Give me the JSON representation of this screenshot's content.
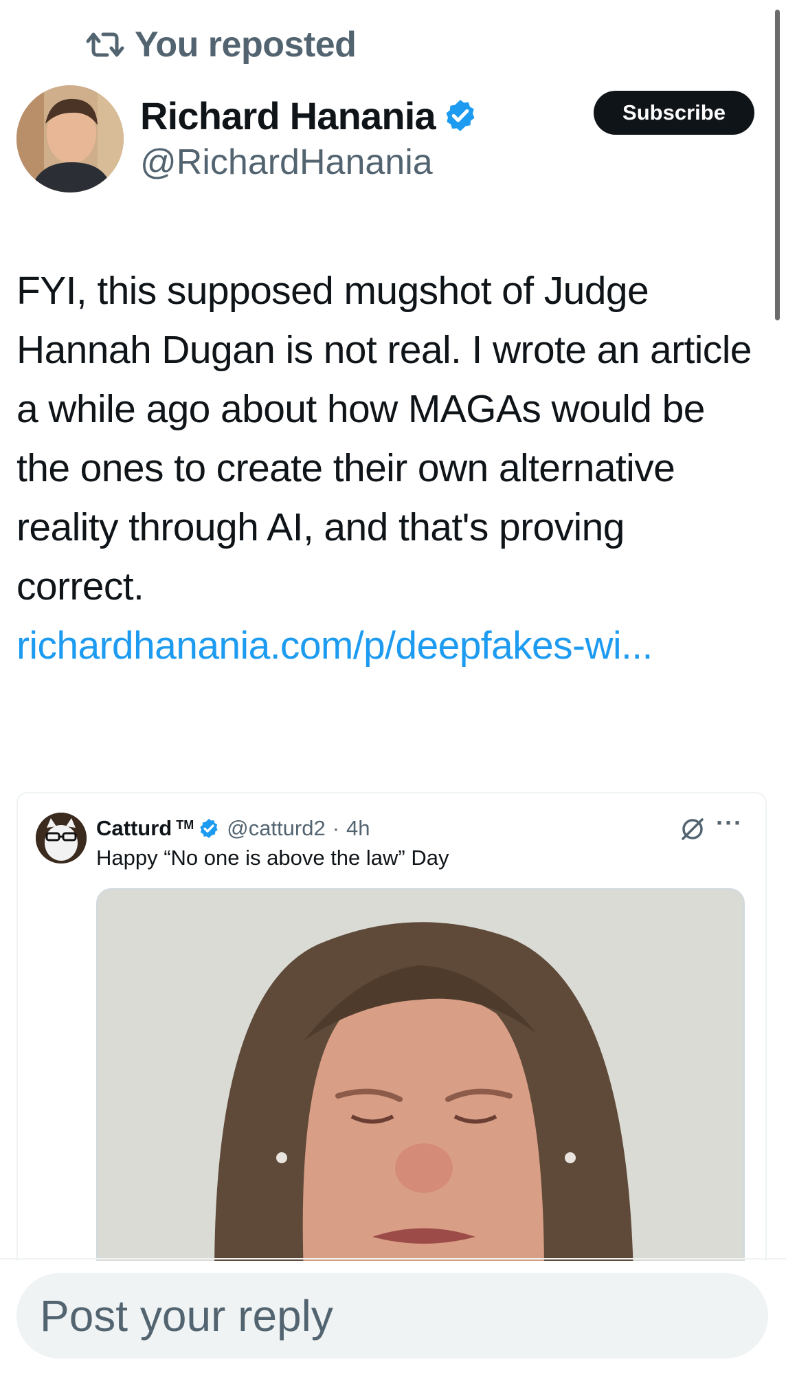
{
  "repost_banner": {
    "icon": "repost-icon",
    "text": "You reposted"
  },
  "author": {
    "name": "Richard Hanania",
    "handle": "@RichardHanania",
    "verified_icon": "verified-badge-icon",
    "subscribe_label": "Subscribe"
  },
  "post": {
    "text": "FYI, this supposed mugshot of Judge Hannah Dugan is not real. I wrote an article a while ago about how MAGAs would be the ones to create their own alternative reality through AI, and that's proving correct.",
    "link_text": "richardhanania.com/p/deepfakes-wi..."
  },
  "quoted_post": {
    "name": "Catturd",
    "trademark": "TM",
    "handle": "@catturd2",
    "separator": "·",
    "time": "4h",
    "text": "Happy “No one is above the law” Day",
    "more": "···",
    "grok_icon": "grok-icon"
  },
  "reply": {
    "placeholder": "Post your reply"
  },
  "colors": {
    "accent": "#1d9bf0",
    "secondary_text": "#536471",
    "primary_text": "#0f1419"
  }
}
